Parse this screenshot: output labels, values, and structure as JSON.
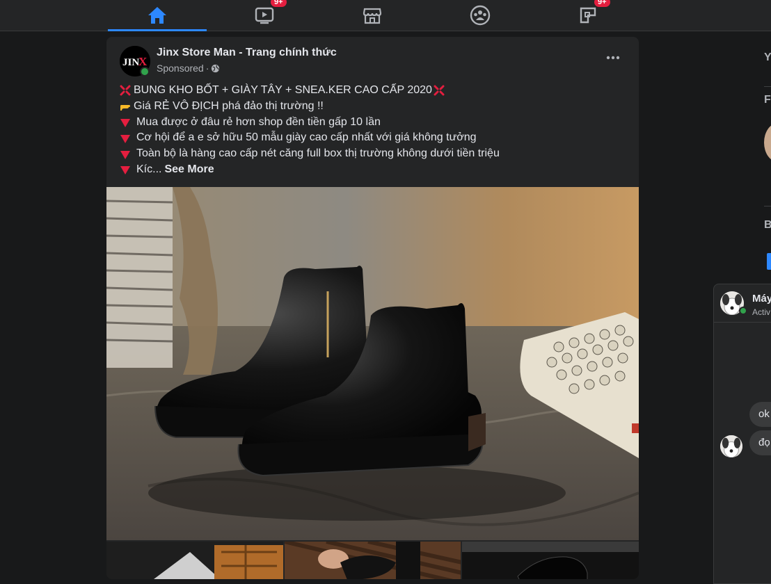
{
  "nav": {
    "tabs": [
      {
        "icon": "home-icon",
        "active": true,
        "badge": ""
      },
      {
        "icon": "watch-icon",
        "active": false,
        "badge": "9+"
      },
      {
        "icon": "marketplace-icon",
        "active": false,
        "badge": ""
      },
      {
        "icon": "groups-icon",
        "active": false,
        "badge": ""
      },
      {
        "icon": "gaming-icon",
        "active": false,
        "badge": "9+"
      }
    ],
    "accent_color": "#2d88ff",
    "badge_color": "#e41e3f"
  },
  "post": {
    "page_name": "Jinx Store Man - Trang chính thức",
    "avatar_text": "JIN",
    "avatar_accent": "X",
    "sponsored": "Sponsored",
    "separator": " · ",
    "lines": [
      {
        "icon": "anger-emoji",
        "text": "BUNG KHO BỐT + GIÀY TÂY + SNEA.KER CAO CẤP 2020"
      },
      {
        "icon": "point-right-emoji",
        "text": "Giá RẺ VÔ ĐỊCH phá đảo thị trường !!"
      },
      {
        "icon": "red-triangle-down",
        "text": "Mua được ở đâu rẻ hơn shop đền tiền gấp 10 lần"
      },
      {
        "icon": "red-triangle-down",
        "text": "Cơ hội để a e sở hữu 50 mẫu giày cao cấp nhất với giá không tưởng"
      },
      {
        "icon": "red-triangle-down",
        "text": "Toàn bộ là hàng cao cấp nét căng full box thị trường không dưới tiền triệu"
      },
      {
        "icon": "red-triangle-down",
        "text": "Kíc..."
      }
    ],
    "see_more": "See More",
    "main_image": "black-chelsea-boots-photo",
    "thumbnails": [
      "shoe-box-photo",
      "hands-holding-shoe-photo",
      "black-shoe-photo"
    ]
  },
  "right_col": {
    "letters": [
      "Y",
      "F",
      "B"
    ]
  },
  "chat": {
    "name": "Máy",
    "status": "Activ",
    "messages": [
      "ok",
      "đọ"
    ]
  }
}
